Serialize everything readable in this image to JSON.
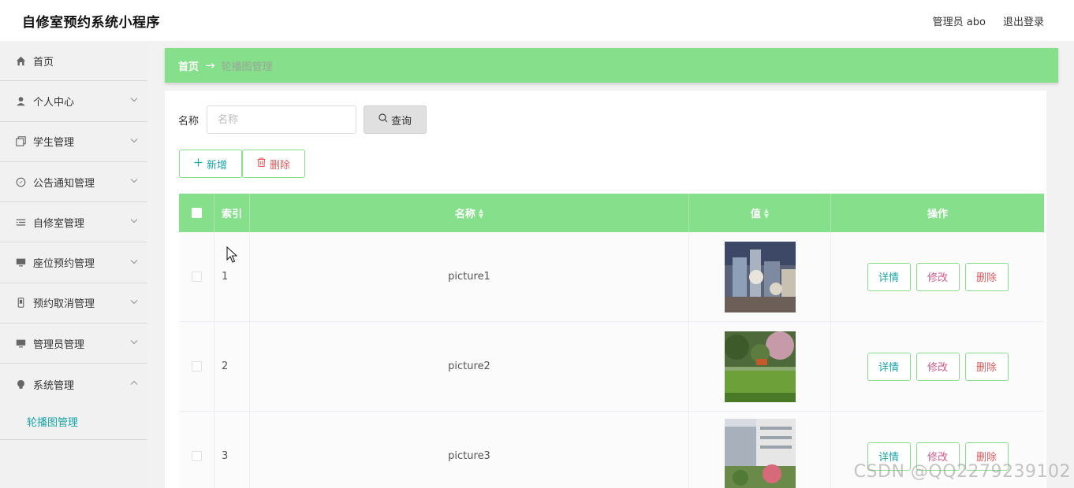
{
  "header": {
    "title": "自修室预约系统小程序",
    "user_label": "管理员 abo",
    "logout_label": "退出登录"
  },
  "sidebar": {
    "items": [
      {
        "label": "首页",
        "icon": "home-icon",
        "has_chevron": false
      },
      {
        "label": "个人中心",
        "icon": "user-icon",
        "has_chevron": true
      },
      {
        "label": "学生管理",
        "icon": "copy-icon",
        "has_chevron": true
      },
      {
        "label": "公告通知管理",
        "icon": "compass-icon",
        "has_chevron": true
      },
      {
        "label": "自修室管理",
        "icon": "list-icon",
        "has_chevron": true
      },
      {
        "label": "座位预约管理",
        "icon": "monitor-icon",
        "has_chevron": true
      },
      {
        "label": "预约取消管理",
        "icon": "mobile-icon",
        "has_chevron": true
      },
      {
        "label": "管理员管理",
        "icon": "monitor-icon",
        "has_chevron": true
      },
      {
        "label": "系统管理",
        "icon": "bulb-icon",
        "has_chevron": true,
        "expanded": true
      }
    ],
    "sub_items": [
      {
        "label": "轮播图管理"
      }
    ]
  },
  "breadcrumb": {
    "home": "首页",
    "separator": "→",
    "current": "轮播图管理"
  },
  "search": {
    "label": "名称",
    "placeholder": "名称",
    "button_label": "查询"
  },
  "actions": {
    "add_label": "新增",
    "delete_label": "删除"
  },
  "table": {
    "columns": [
      "索引",
      "名称",
      "值",
      "操作"
    ],
    "rows": [
      {
        "index": "1",
        "name": "picture1",
        "value_image": "building-glass-photo"
      },
      {
        "index": "2",
        "name": "picture2",
        "value_image": "garden-lawn-photo"
      },
      {
        "index": "3",
        "name": "picture3",
        "value_image": "campus-building-photo"
      }
    ],
    "row_actions": {
      "detail": "详情",
      "edit": "修改",
      "delete": "删除"
    }
  },
  "watermark": "CSDN @QQ2279239102",
  "colors": {
    "accent_green": "#86df8b",
    "teal_text": "#1aa5a5",
    "danger_text": "#e35b5b",
    "edit_text": "#d45c8a"
  }
}
